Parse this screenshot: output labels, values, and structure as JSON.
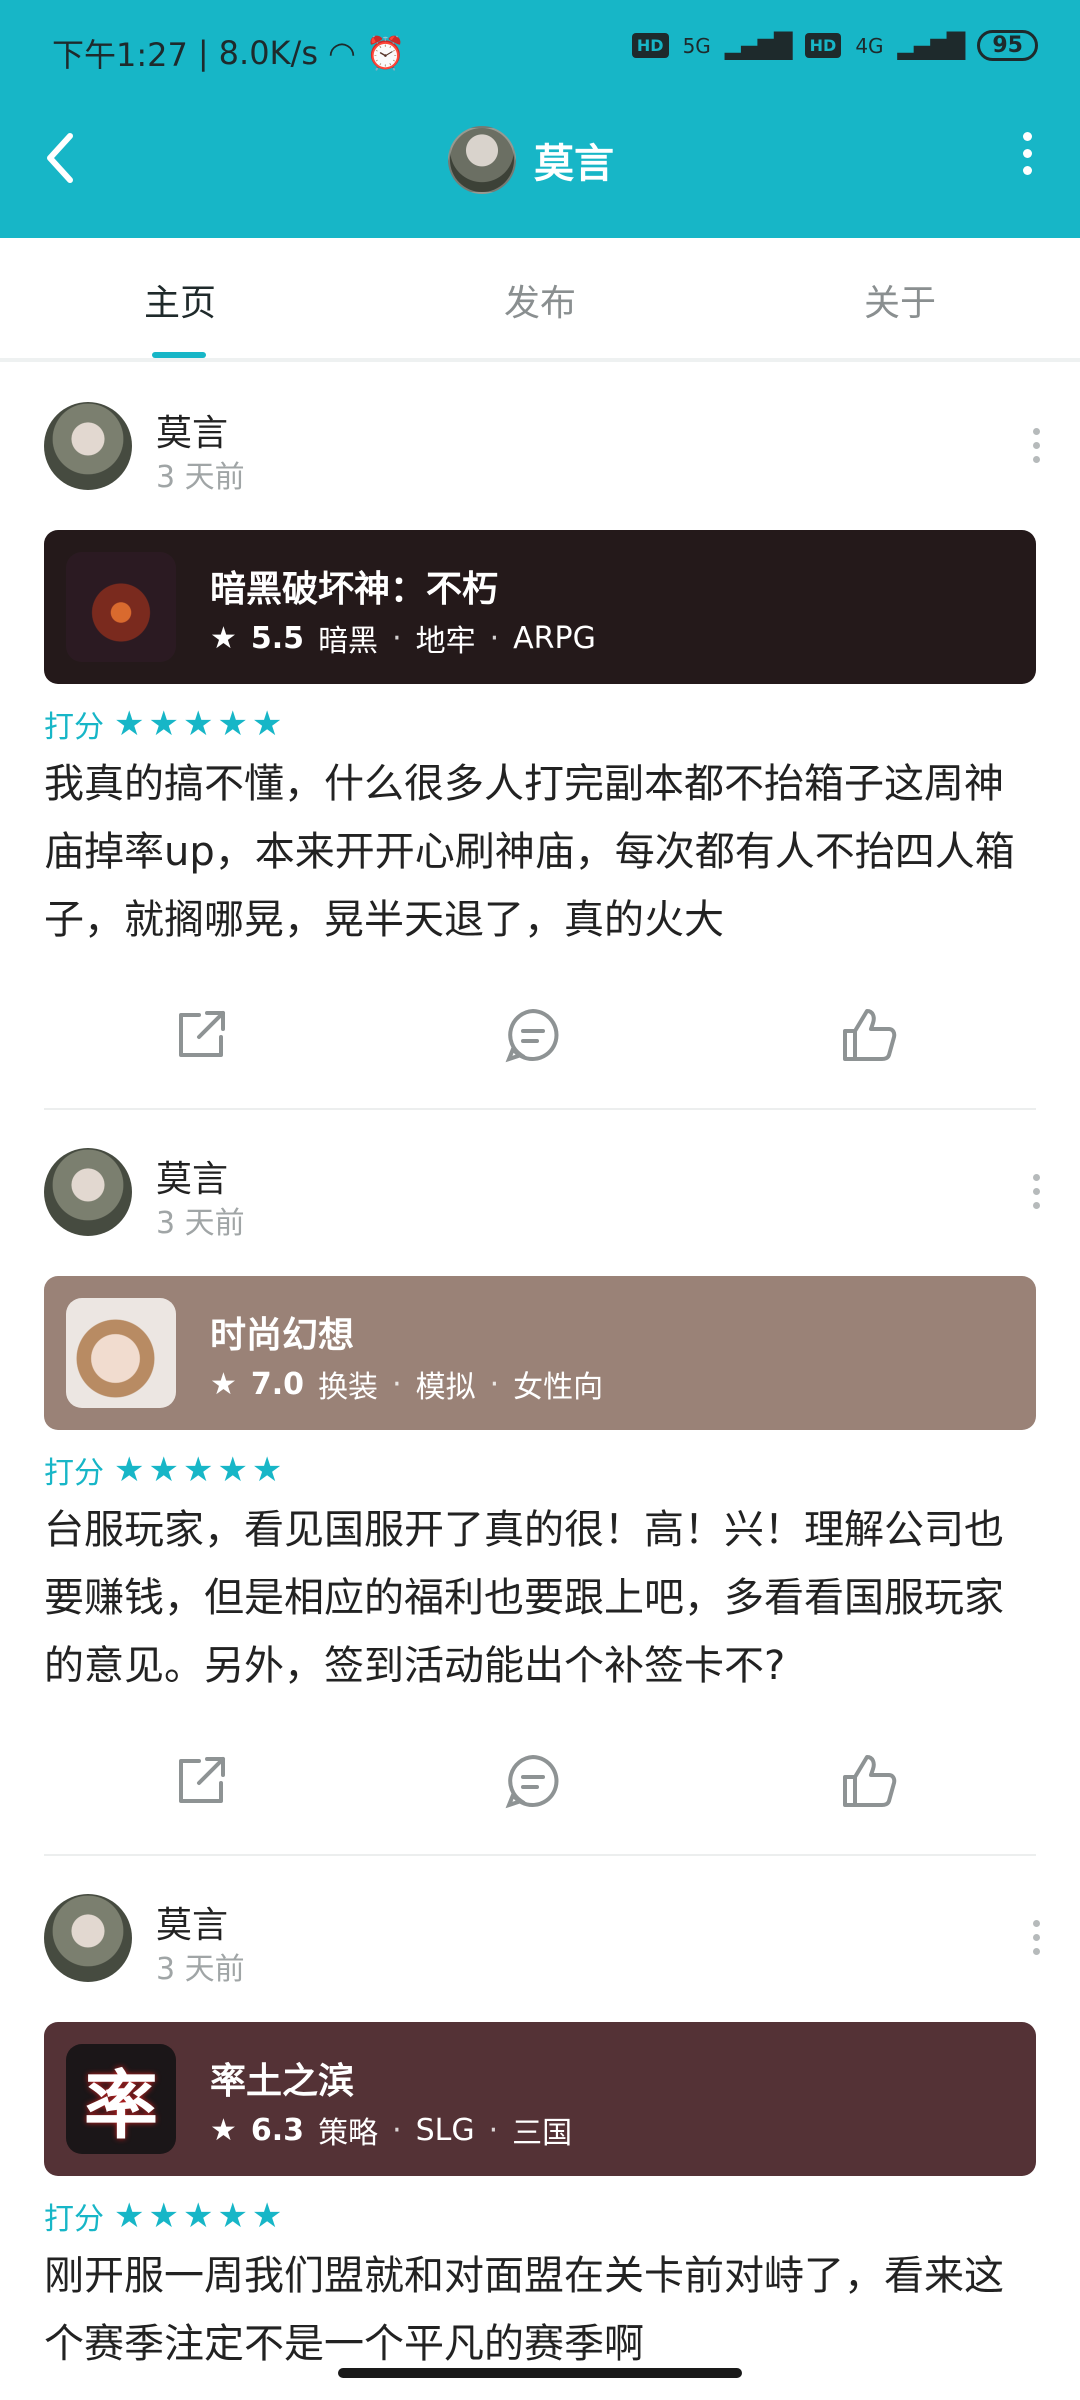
{
  "status_bar": {
    "time": "下午1:27",
    "net_speed": "8.0K/s",
    "hd1": "HD",
    "net1": "5G",
    "hd2": "HD",
    "net2": "4G",
    "battery": "95"
  },
  "header": {
    "title": "莫言"
  },
  "tabs": [
    {
      "label": "主页"
    },
    {
      "label": "发布"
    },
    {
      "label": "关于"
    }
  ],
  "posts": [
    {
      "author": "莫言",
      "time": "3 天前",
      "game": {
        "name": "暗黑破坏神：不朽",
        "score": "5.5",
        "tags": [
          "暗黑",
          "地牢",
          "ARPG"
        ],
        "bg": "#24191a"
      },
      "rating_label": "打分",
      "stars": "★★★★★",
      "content": "我真的搞不懂，什么很多人打完副本都不抬箱子这周神庙掉率up，本来开开心刷神庙，每次都有人不抬四人箱子，就搁哪晃，晃半天退了，真的火大"
    },
    {
      "author": "莫言",
      "time": "3 天前",
      "game": {
        "name": "时尚幻想",
        "score": "7.0",
        "tags": [
          "换装",
          "模拟",
          "女性向"
        ],
        "bg": "#9a8277"
      },
      "rating_label": "打分",
      "stars": "★★★★★",
      "content": "台服玩家，看见国服开了真的很！高！兴！理解公司也要赚钱，但是相应的福利也要跟上吧，多看看国服玩家的意见。另外，签到活动能出个补签卡不?"
    },
    {
      "author": "莫言",
      "time": "3 天前",
      "game": {
        "name": "率土之滨",
        "score": "6.3",
        "tags": [
          "策略",
          "SLG",
          "三国"
        ],
        "bg": "#543236",
        "icon_char": "率"
      },
      "rating_label": "打分",
      "stars": "★★★★★",
      "content": "刚开服一周我们盟就和对面盟在关卡前对峙了，看来这个赛季注定不是一个平凡的赛季啊"
    }
  ],
  "colors": {
    "accent": "#17b6c7"
  }
}
